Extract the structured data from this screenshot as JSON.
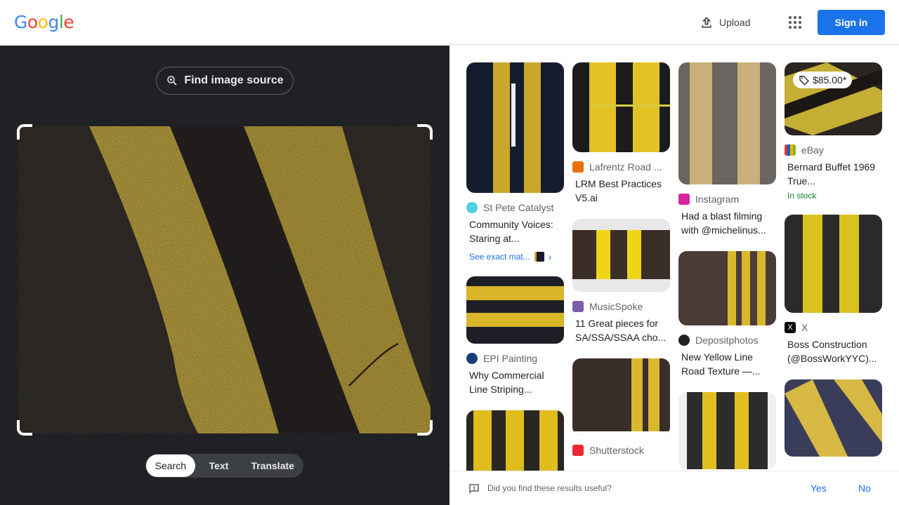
{
  "header": {
    "logo_letters": [
      "G",
      "o",
      "o",
      "g",
      "l",
      "e"
    ],
    "logo_colors": [
      "#4285f4",
      "#ea4335",
      "#fbbc05",
      "#4285f4",
      "#34a853",
      "#ea4335"
    ],
    "upload_label": "Upload",
    "apps_icon": "apps-grid-icon",
    "signin_label": "Sign in"
  },
  "query_panel": {
    "find_source_label": "Find image source",
    "tabs": [
      "Search",
      "Text",
      "Translate"
    ],
    "active_tab": "Search"
  },
  "results": {
    "col1": [
      {
        "source": "St Pete Catalyst",
        "title": "Community Voices: Staring at...",
        "favicon_color": "#4dd0e1",
        "exact_label": "See exact mat..."
      },
      {
        "source": "EPI Painting",
        "title": "Why Commercial Line Striping...",
        "favicon_color": "#1a3d7c"
      },
      {
        "source": "",
        "title": ""
      }
    ],
    "col2": [
      {
        "source": "Lafrentz Road ...",
        "title": "LRM Best Practices V5.ai",
        "favicon_color": "#e8710a"
      },
      {
        "source": "MusicSpoke",
        "title": "11 Great pieces for SA/SSA/SSAA cho...",
        "favicon_color": "#7b5ea7"
      },
      {
        "source": "Shutterstock",
        "title": "",
        "favicon_color": "#ee2737"
      }
    ],
    "col3": [
      {
        "source": "Instagram",
        "title": "Had a blast filming with @michelinus...",
        "favicon_color": "#d6249f"
      },
      {
        "source": "Depositphotos",
        "title": "New Yellow Line Road Texture —...",
        "favicon_color": "#202124"
      },
      {
        "source": "",
        "title": ""
      }
    ],
    "col4": [
      {
        "price": "$85.00*",
        "source": "eBay",
        "title": "Bernard Buffet 1969 True...",
        "stock": "In stock",
        "favicon_color": "#e53238"
      },
      {
        "source": "X",
        "title": "Boss Construction (@BossWorkYYC)...",
        "favicon_color": "#000000"
      },
      {
        "source": "",
        "title": ""
      }
    ]
  },
  "feedback": {
    "question": "Did you find these results useful?",
    "yes_label": "Yes",
    "no_label": "No"
  }
}
